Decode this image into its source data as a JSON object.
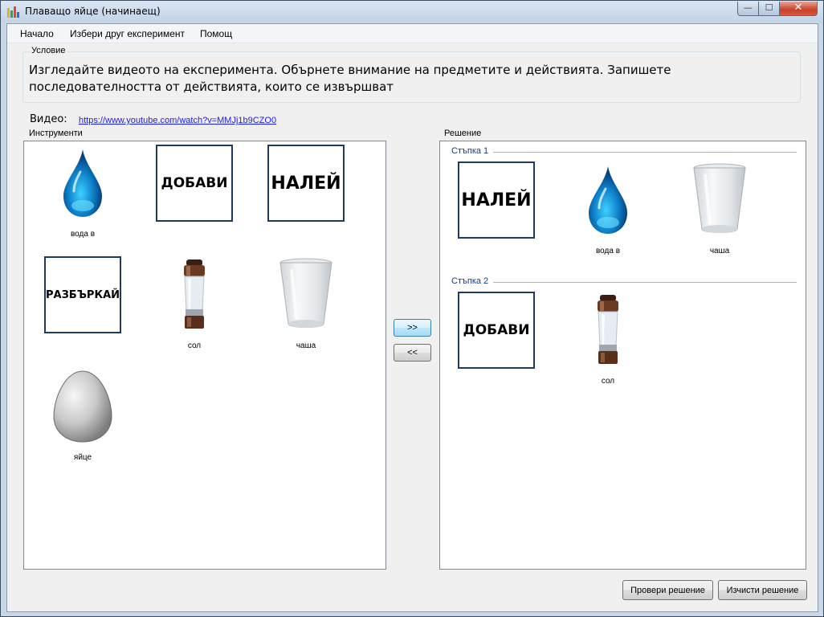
{
  "window": {
    "title": "Плаващо яйце (начинаещ)",
    "min_glyph": "—",
    "max_glyph": "☐",
    "close_glyph": "✕"
  },
  "menu": {
    "items": [
      "Начало",
      "Избери друг експеримент",
      "Помощ"
    ]
  },
  "condition": {
    "group_label": "Условие",
    "text": "Изгледайте видеото на експеримента.  Обърнете внимание на предметите и действията. Запишете последователността от действията, които се извършват"
  },
  "video": {
    "label": "Видео:",
    "url": "https://www.youtube.com/watch?v=MMJj1b9CZO0"
  },
  "tools": {
    "group_label": "Инструменти",
    "items": [
      {
        "kind": "water-drop",
        "caption": "вода в"
      },
      {
        "kind": "word",
        "word": "ДОБАВИ",
        "caption": ""
      },
      {
        "kind": "word",
        "word": "НАЛЕЙ",
        "caption": ""
      },
      {
        "kind": "word",
        "word": "РАЗБЪРКАЙ",
        "caption": ""
      },
      {
        "kind": "salt-shaker",
        "caption": "сол"
      },
      {
        "kind": "glass",
        "caption": "чаша"
      },
      {
        "kind": "egg",
        "caption": "яйце"
      }
    ]
  },
  "transfer": {
    "add_label": ">>",
    "remove_label": "<<"
  },
  "solution": {
    "group_label": "Решение",
    "steps": [
      {
        "title": "Стъпка 1",
        "items": [
          {
            "kind": "word",
            "word": "НАЛЕЙ",
            "caption": ""
          },
          {
            "kind": "water-drop",
            "caption": "вода в"
          },
          {
            "kind": "glass",
            "caption": "чаша"
          }
        ]
      },
      {
        "title": "Стъпка 2",
        "items": [
          {
            "kind": "word",
            "word": "ДОБАВИ",
            "caption": ""
          },
          {
            "kind": "salt-shaker",
            "caption": "сол"
          }
        ]
      }
    ]
  },
  "footer": {
    "check_label": "Провери решение",
    "clear_label": "Изчисти решение"
  },
  "colors": {
    "card_border": "#1e3a5f",
    "step_title": "#1a3a8a",
    "link": "#1a1aff"
  }
}
